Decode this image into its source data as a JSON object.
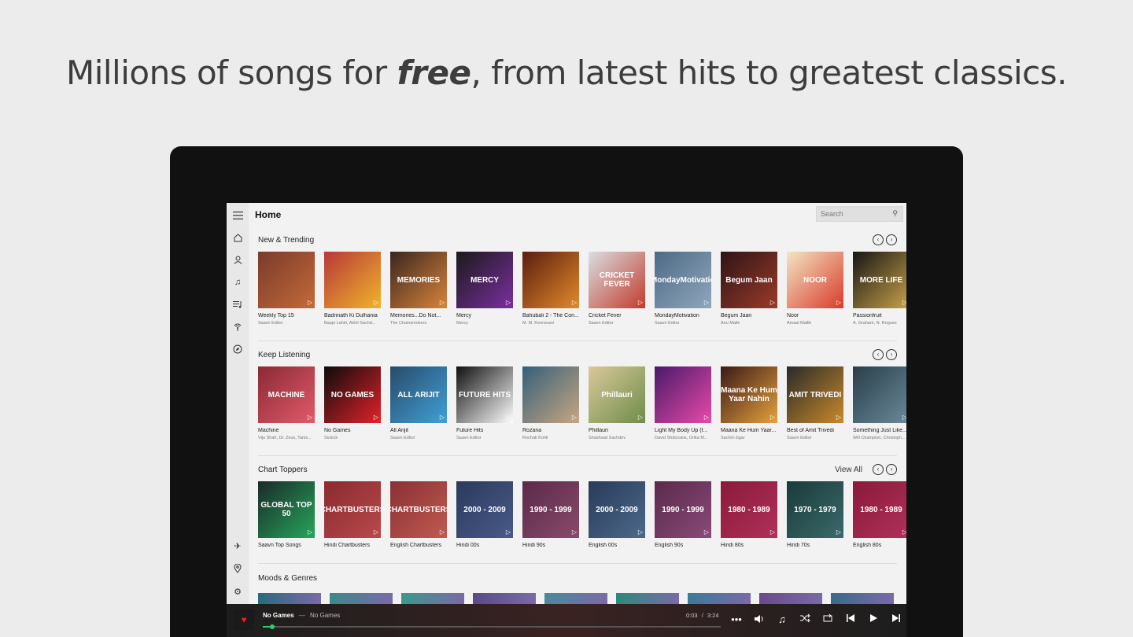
{
  "headline": {
    "before": "Millions of songs for ",
    "emphasis": "free",
    "after": ", from latest hits to greatest classics."
  },
  "app": {
    "page_title": "Home",
    "search_placeholder": "Search"
  },
  "sidebar": {
    "icons": [
      "menu-icon",
      "home-icon",
      "profile-icon",
      "music-note-icon",
      "playlist-icon",
      "radio-icon",
      "compass-icon",
      "airplane-icon",
      "location-icon",
      "settings-icon"
    ]
  },
  "sections": {
    "new_trending": {
      "title": "New & Trending",
      "items": [
        {
          "title": "Weekly Top 15",
          "sub": "Saavn Editor",
          "color": "#7a3b2a",
          "accent": "#c46a3a",
          "label": ""
        },
        {
          "title": "Badrinath Ki Dulhania",
          "sub": "Bappi Lahiri, Akhil Sachd...",
          "color": "#b8383b",
          "accent": "#f0b429",
          "label": ""
        },
        {
          "title": "Memories...Do Not...",
          "sub": "The Chainsmokers",
          "color": "#3a2620",
          "accent": "#d9843a",
          "label": "MEMORIES"
        },
        {
          "title": "Mercy",
          "sub": "Mercy",
          "color": "#1a1a1a",
          "accent": "#7b2fa0",
          "label": "MERCY"
        },
        {
          "title": "Bahubali 2 - The Con...",
          "sub": "M. M. Keeravani",
          "color": "#5b1d10",
          "accent": "#e28a2a",
          "label": ""
        },
        {
          "title": "Cricket Fever",
          "sub": "Saavn Editor",
          "color": "#d9dfe3",
          "accent": "#c23b2b",
          "label": "CRICKET FEVER"
        },
        {
          "title": "MondayMotivation",
          "sub": "Saavn Editor",
          "color": "#4d6a85",
          "accent": "#8fa7bd",
          "label": "#MondayMotivation"
        },
        {
          "title": "Begum Jaan",
          "sub": "Anu Malik",
          "color": "#2e1515",
          "accent": "#9b3a2a",
          "label": "Begum Jaan"
        },
        {
          "title": "Noor",
          "sub": "Amaal Mallik",
          "color": "#f2e6c4",
          "accent": "#d93a2a",
          "label": "NOOR"
        },
        {
          "title": "Passionfruit",
          "sub": "A. Graham, N. Rogues",
          "color": "#161616",
          "accent": "#c9a24a",
          "label": "MORE LIFE"
        }
      ]
    },
    "keep_listening": {
      "title": "Keep Listening",
      "items": [
        {
          "title": "Machine",
          "sub": "Viju Shah, Dr. Zeus, Tanis...",
          "color": "#8a2a35",
          "accent": "#e35a6a",
          "label": "MACHINE"
        },
        {
          "title": "No Games",
          "sub": "Sickick",
          "color": "#0c0c0c",
          "accent": "#e3222a",
          "label": "NO GAMES"
        },
        {
          "title": "All Arijit",
          "sub": "Saavn Editor",
          "color": "#2a4a6a",
          "accent": "#3fa1d6",
          "label": "ALL ARIJIT"
        },
        {
          "title": "Future Hits",
          "sub": "Saavn Editor",
          "color": "#101010",
          "accent": "#ffffff",
          "label": "FUTURE HITS"
        },
        {
          "title": "Rozana",
          "sub": "Rochak Kohli",
          "color": "#355f7a",
          "accent": "#c7a682",
          "label": ""
        },
        {
          "title": "Phillauri",
          "sub": "Shashwat Sachdev",
          "color": "#d9c89a",
          "accent": "#6f8c4a",
          "label": "Phillauri"
        },
        {
          "title": "Light My Body Up (f...",
          "sub": "David Shdovskis, Orika M...",
          "color": "#4a1a6a",
          "accent": "#e84aa8",
          "label": ""
        },
        {
          "title": "Maana Ke Hum Yaar...",
          "sub": "Sachin-Jigar",
          "color": "#3a1a18",
          "accent": "#e6a13a",
          "label": "Maana Ke Hum Yaar Nahin"
        },
        {
          "title": "Best of Amit Trivedi",
          "sub": "Saavn Editor",
          "color": "#2a2a2a",
          "accent": "#c88a2a",
          "label": "AMIT TRIVEDI"
        },
        {
          "title": "Something Just Like...",
          "sub": "Will Champion, Christoph...",
          "color": "#2a3e4a",
          "accent": "#6a8a9a",
          "label": ""
        }
      ]
    },
    "chart_toppers": {
      "title": "Chart Toppers",
      "view_all": "View All",
      "items": [
        {
          "title": "Saavn Top Songs",
          "color": "#1a2a2a",
          "accent": "#26a65b",
          "label": "GLOBAL TOP 50"
        },
        {
          "title": "Hindi Chartbusters",
          "color": "#8a2a30",
          "accent": "#b84a4a",
          "label": "CHARTBUSTERS"
        },
        {
          "title": "English Chartbusters",
          "color": "#8a3035",
          "accent": "#c05a50",
          "label": "CHARTBUSTERS"
        },
        {
          "title": "Hindi 00s",
          "color": "#2a3a5a",
          "accent": "#4a5a8a",
          "label": "2000 - 2009"
        },
        {
          "title": "Hindi 90s",
          "color": "#5a2a4a",
          "accent": "#8a4a6a",
          "label": "1990 - 1999"
        },
        {
          "title": "English 00s",
          "color": "#2a3a5a",
          "accent": "#4a6a8a",
          "label": "2000 - 2009"
        },
        {
          "title": "English 90s",
          "color": "#5a2a4a",
          "accent": "#8a4a7a",
          "label": "1990 - 1999"
        },
        {
          "title": "Hindi 80s",
          "color": "#8a1a3a",
          "accent": "#b0305a",
          "label": "1980 - 1989"
        },
        {
          "title": "Hindi 70s",
          "color": "#1a3a3a",
          "accent": "#3a6a6a",
          "label": "1970 - 1979"
        },
        {
          "title": "English 80s",
          "color": "#8a1a3a",
          "accent": "#b0305a",
          "label": "1980 - 1989"
        }
      ]
    },
    "moods_genres": {
      "title": "Moods & Genres",
      "colors": [
        "#2a6a7a",
        "#3a8a8a",
        "#3a9a8a",
        "#5a4a8a",
        "#4a8a9a",
        "#2a8a7a",
        "#3a7a9a",
        "#6a4a8a",
        "#3a6a8a"
      ]
    }
  },
  "player": {
    "track": "No Games",
    "separator": "—",
    "artist": "No Games",
    "elapsed": "0:03",
    "total": "3:24",
    "time_separator": "/",
    "progress": 0.02,
    "controls": [
      "more-icon",
      "volume-icon",
      "queue-icon",
      "shuffle-icon",
      "repeat-icon",
      "previous-icon",
      "play-icon",
      "next-icon"
    ]
  }
}
